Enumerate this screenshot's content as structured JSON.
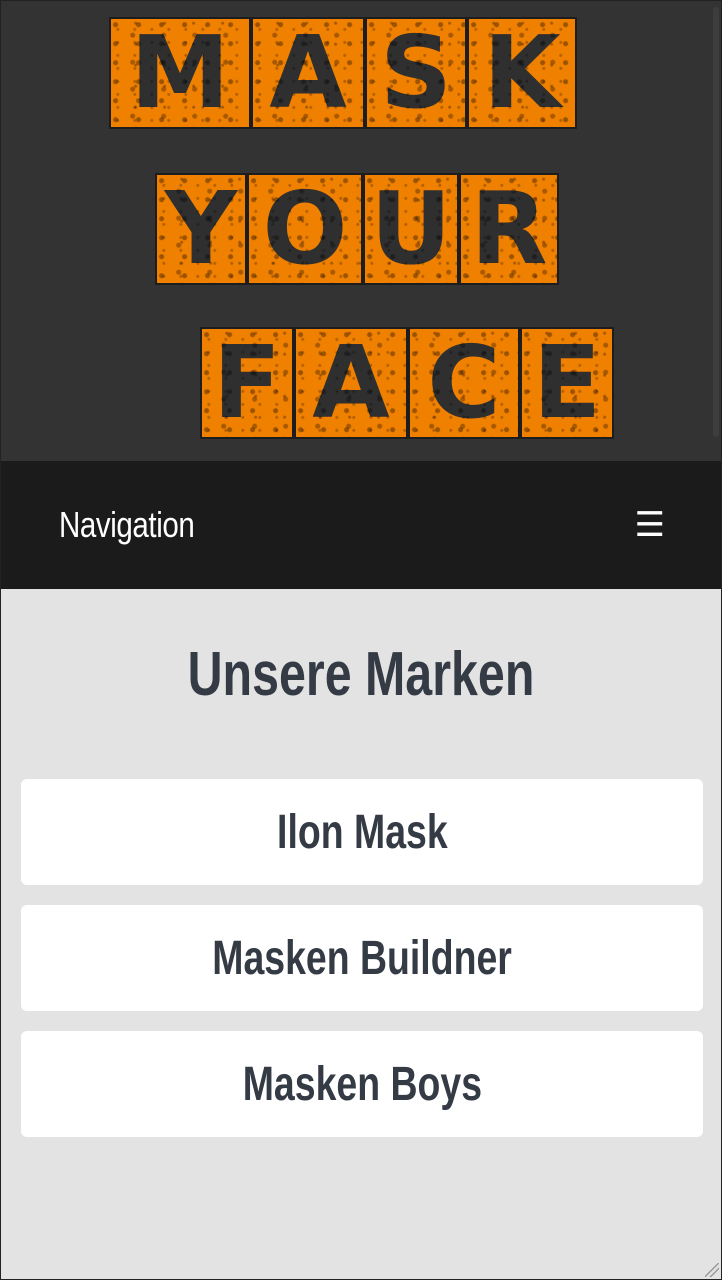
{
  "logo": {
    "line1": [
      "M",
      "A",
      "S",
      "K"
    ],
    "line2": [
      "Y",
      "O",
      "U",
      "R"
    ],
    "line3": [
      "F",
      "A",
      "C",
      "E"
    ],
    "tile_color": "#f08000",
    "letter_color": "#2f2f2f"
  },
  "navbar": {
    "title": "Navigation",
    "menu_icon": "hamburger-icon",
    "menu_glyph": "☰"
  },
  "main": {
    "heading": "Unsere Marken",
    "brands": [
      {
        "label": "Ilon Mask"
      },
      {
        "label": "Masken Buildner"
      },
      {
        "label": "Masken Boys"
      }
    ]
  },
  "colors": {
    "header_bg": "#333333",
    "navbar_bg": "#1b1b1b",
    "page_bg": "#e3e3e3",
    "text_dark": "#343b45"
  }
}
